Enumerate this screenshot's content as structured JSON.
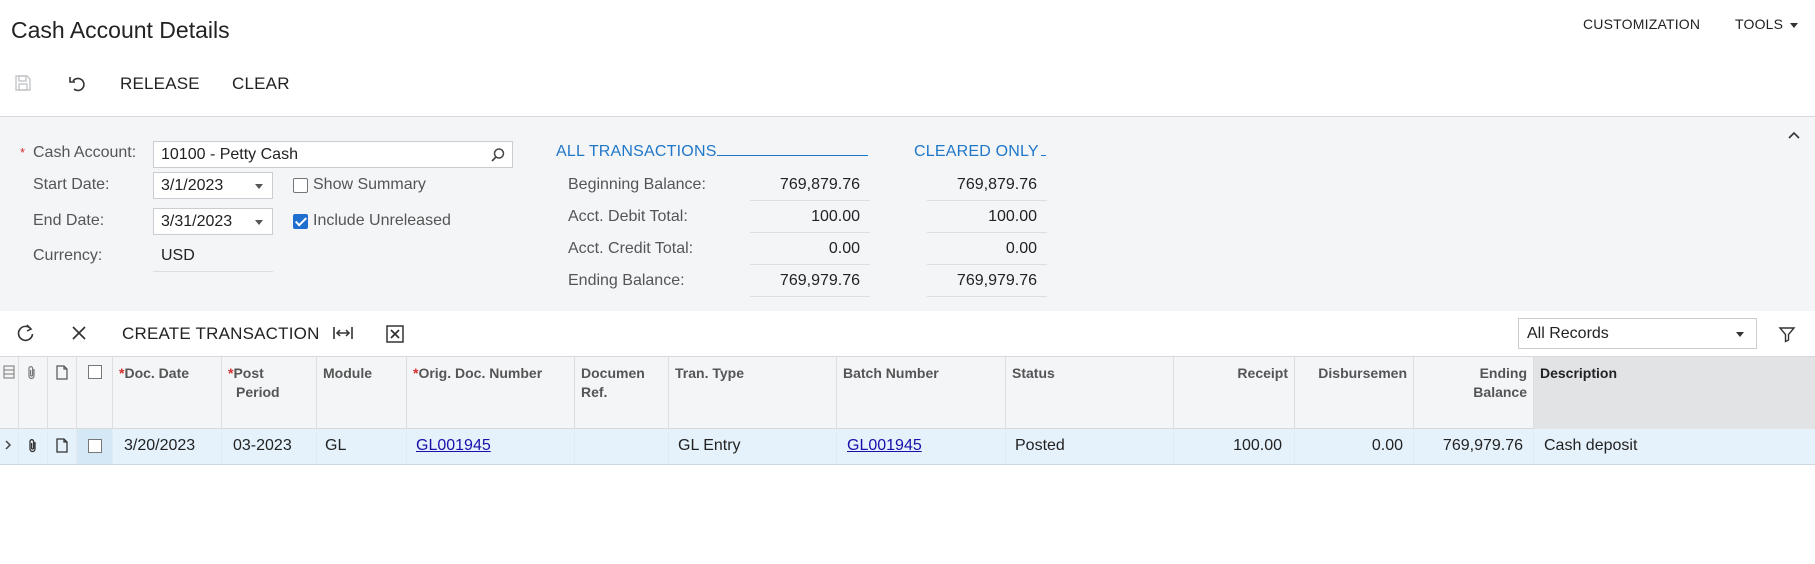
{
  "header": {
    "title": "Cash Account Details",
    "customization_label": "CUSTOMIZATION",
    "tools_label": "TOOLS"
  },
  "toolbar": {
    "release_label": "RELEASE",
    "clear_label": "CLEAR"
  },
  "form": {
    "cash_account_label": "Cash Account:",
    "cash_account_value": "10100 - Petty Cash",
    "start_date_label": "Start Date:",
    "start_date_value": "3/1/2023",
    "end_date_label": "End Date:",
    "end_date_value": "3/31/2023",
    "currency_label": "Currency:",
    "currency_value": "USD",
    "show_summary_label": "Show Summary",
    "show_summary_checked": false,
    "include_unreleased_label": "Include Unreleased",
    "include_unreleased_checked": true
  },
  "balances": {
    "all_header": "ALL TRANSACTIONS",
    "cleared_header": "CLEARED ONLY",
    "rows": [
      {
        "label": "Beginning Balance:",
        "all": "769,879.76",
        "cleared": "769,879.76"
      },
      {
        "label": "Acct. Debit Total:",
        "all": "100.00",
        "cleared": "100.00"
      },
      {
        "label": "Acct. Credit Total:",
        "all": "0.00",
        "cleared": "0.00"
      },
      {
        "label": "Ending Balance:",
        "all": "769,979.76",
        "cleared": "769,979.76"
      }
    ]
  },
  "grid_toolbar": {
    "create_transaction_label": "CREATE TRANSACTION",
    "filter_value": "All Records"
  },
  "grid": {
    "columns": {
      "doc_date": "Doc. Date",
      "post_period_1": "Post",
      "post_period_2": "Period",
      "module": "Module",
      "orig_doc_number": "Orig. Doc. Number",
      "document_ref_1": "Documen",
      "document_ref_2": "Ref.",
      "tran_type": "Tran. Type",
      "batch_number": "Batch Number",
      "status": "Status",
      "receipt": "Receipt",
      "disbursement": "Disbursemen",
      "ending_balance_1": "Ending",
      "ending_balance_2": "Balance",
      "description": "Description"
    },
    "rows": [
      {
        "doc_date": "3/20/2023",
        "post_period": "03-2023",
        "module": "GL",
        "orig_doc_number": "GL001945",
        "document_ref": "",
        "tran_type": "GL Entry",
        "batch_number": "GL001945",
        "status": "Posted",
        "receipt": "100.00",
        "disbursement": "0.00",
        "ending_balance": "769,979.76",
        "description": "Cash deposit"
      }
    ]
  },
  "colors": {
    "accent": "#1f77c8",
    "required": "#d32f2f",
    "row_selected": "#e6f2fb",
    "link": "#1a0dab"
  },
  "icons": [
    "save-icon",
    "undo-icon",
    "search-icon",
    "collapse-icon",
    "refresh-icon",
    "close-icon",
    "fit-columns-icon",
    "export-excel-icon",
    "filter-icon",
    "attachment-icon",
    "note-icon"
  ]
}
